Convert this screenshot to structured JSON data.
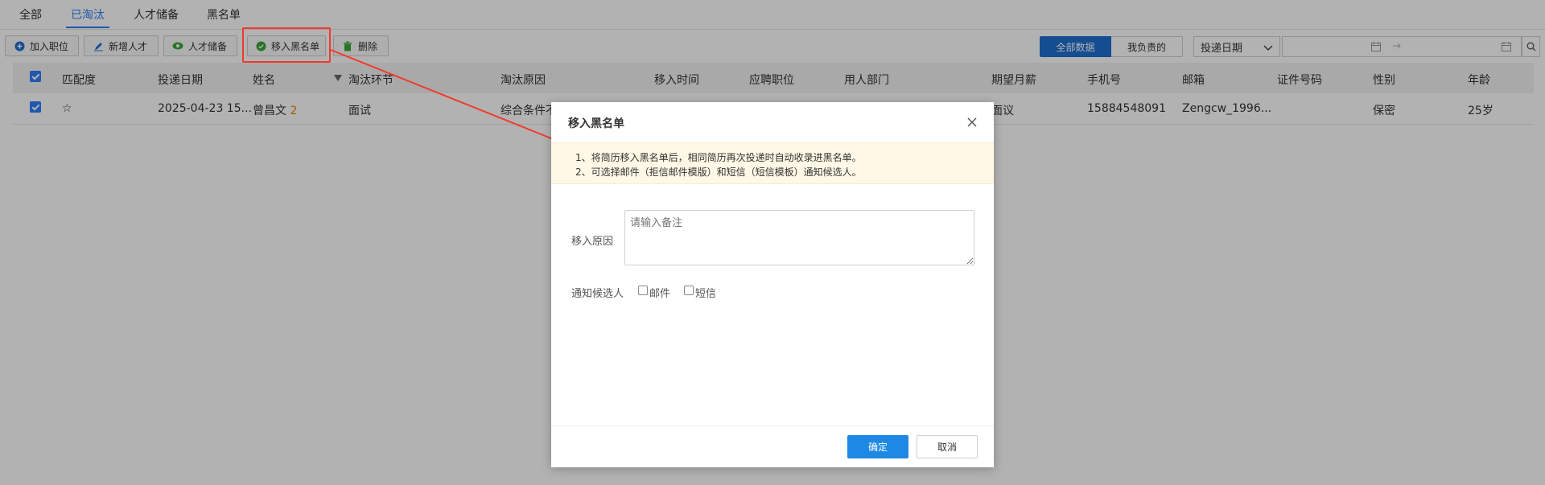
{
  "tabs": [
    {
      "label": "全部",
      "active": false
    },
    {
      "label": "已淘汰",
      "active": true
    },
    {
      "label": "人才储备",
      "active": false
    },
    {
      "label": "黑名单",
      "active": false
    }
  ],
  "toolbar": {
    "add_position": "加入职位",
    "add_talent": "新增人才",
    "talent_reserve": "人才储备",
    "move_blacklist": "移入黑名单",
    "delete": "删除",
    "all_data": "全部数据",
    "mine": "我负责的",
    "date_select": "投递日期"
  },
  "table": {
    "headers": [
      "匹配度",
      "投递日期",
      "姓名",
      "淘汰环节",
      "淘汰原因",
      "移入时间",
      "应聘职位",
      "用人部门",
      "期望月薪",
      "手机号",
      "邮箱",
      "证件号码",
      "性别",
      "年龄"
    ],
    "rows": [
      {
        "match": "☆",
        "date": "2025-04-23 15...",
        "name": "曾昌文",
        "name_count": "2",
        "stage": "面试",
        "reason": "综合条件不",
        "salary": "面议",
        "phone": "15884548091",
        "email": "Zengcw_1996...",
        "gender": "保密",
        "age": "25岁"
      }
    ]
  },
  "dialog": {
    "title": "移入黑名单",
    "notice_1": "1、将简历移入黑名单后，相同简历再次投递时自动收录进黑名单。",
    "notice_2": "2、可选择邮件（拒信邮件模版）和短信（短信模板）通知候选人。",
    "reason_label": "移入原因",
    "reason_placeholder": "请输入备注",
    "notify_label": "通知候选人",
    "email_option": "邮件",
    "sms_option": "短信",
    "confirm": "确定",
    "cancel": "取消"
  },
  "colors": {
    "primary": "#1e88e5",
    "active_tab": "#2d7ff9",
    "annotation_red": "#f03a2a",
    "notice_bg": "#fff8e6"
  }
}
